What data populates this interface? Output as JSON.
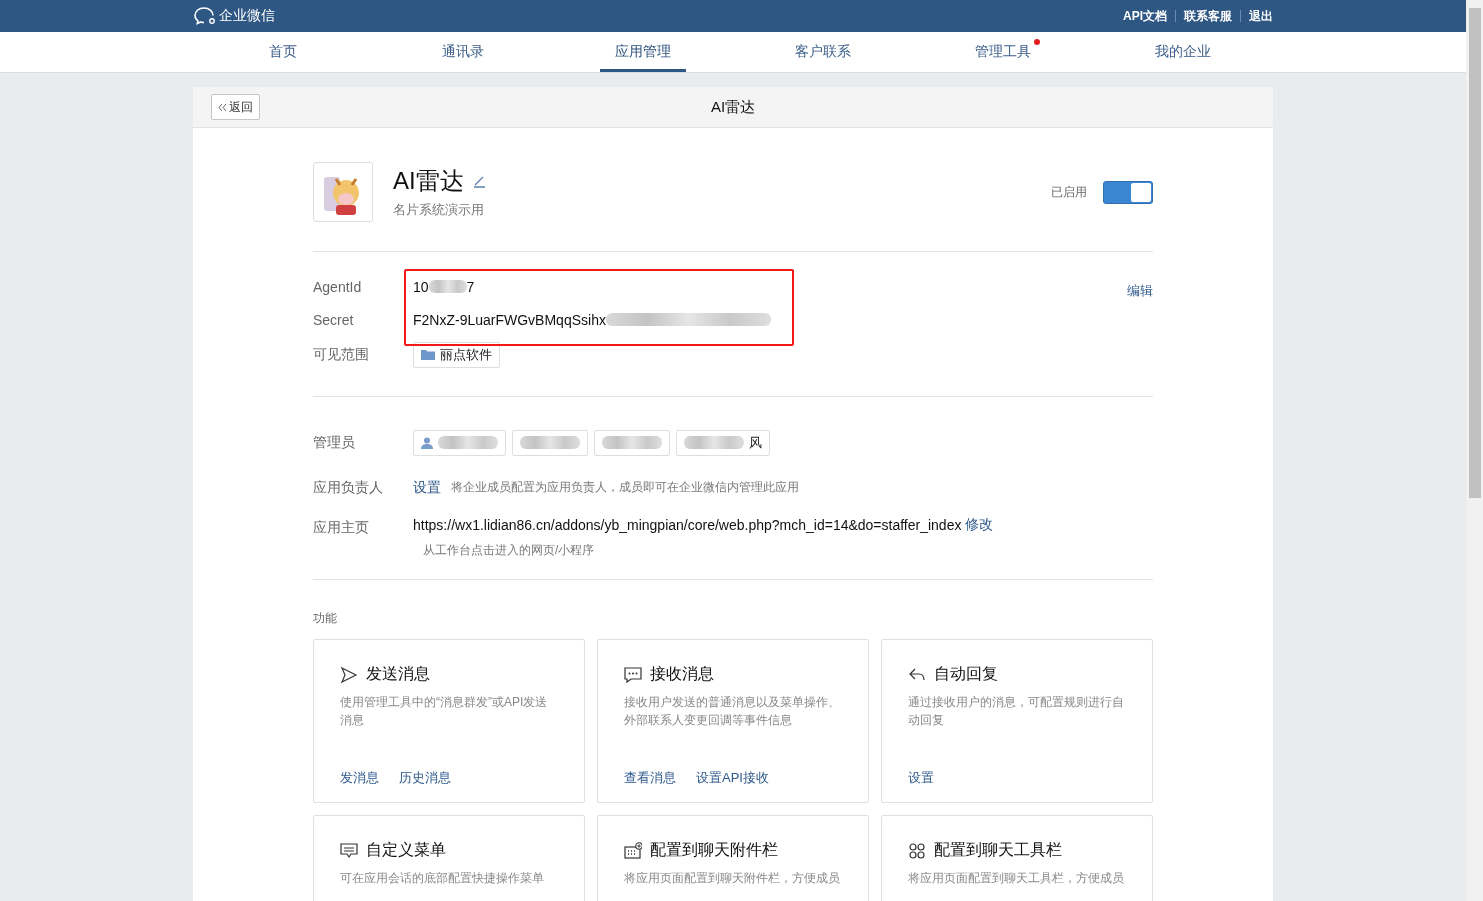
{
  "topbar": {
    "logo_text": "企业微信",
    "links": [
      "API文档",
      "联系客服",
      "退出"
    ]
  },
  "nav": [
    {
      "label": "首页",
      "selected": false,
      "badge": false
    },
    {
      "label": "通讯录",
      "selected": false,
      "badge": false
    },
    {
      "label": "应用管理",
      "selected": true,
      "badge": false
    },
    {
      "label": "客户联系",
      "selected": false,
      "badge": false
    },
    {
      "label": "管理工具",
      "selected": false,
      "badge": true
    },
    {
      "label": "我的企业",
      "selected": false,
      "badge": false
    }
  ],
  "page": {
    "back_button": "返回",
    "title": "AI雷达"
  },
  "app": {
    "name": "AI雷达",
    "description": "名片系统演示用",
    "status_label": "已启用",
    "enabled": true
  },
  "credentials": {
    "edit_link": "编辑",
    "agent_label": "AgentId",
    "agent_id_start": "10",
    "agent_id_end": "7",
    "secret_label": "Secret",
    "secret": "F2NxZ-9LuarFWGvBMqqSsihx"
  },
  "visibility": {
    "label": "可见范围",
    "scope": "丽点软件"
  },
  "admins": {
    "label": "管理员",
    "chips": [
      {
        "kind": "person"
      },
      {
        "kind": "plain"
      },
      {
        "kind": "plain"
      },
      {
        "kind": "plain",
        "text": "风"
      }
    ]
  },
  "owner": {
    "label": "应用负责人",
    "link": "设置",
    "hint": "将企业成员配置为应用负责人，成员即可在企业微信内管理此应用"
  },
  "homepage": {
    "label": "应用主页",
    "url": "https://wx1.lidian86.cn/addons/yb_mingpian/core/web.php?mch_id=14&do=staffer_index",
    "edit_link": "修改",
    "hint": "从工作台点击进入的网页/小程序"
  },
  "features": {
    "title": "功能",
    "cards": [
      {
        "kind": "send",
        "title": "发送消息",
        "description": "使用管理工具中的“消息群发”或API发送消息",
        "links": [
          "发消息",
          "历史消息"
        ]
      },
      {
        "kind": "receive",
        "title": "接收消息",
        "description": "接收用户发送的普通消息以及菜单操作、外部联系人变更回调等事件信息",
        "links": [
          "查看消息",
          "设置API接收"
        ]
      },
      {
        "kind": "reply",
        "title": "自动回复",
        "description": "通过接收用户的消息，可配置规则进行自动回复",
        "links": [
          "设置"
        ]
      },
      {
        "kind": "menu",
        "title": "自定义菜单",
        "description": "可在应用会话的底部配置快捷操作菜单"
      },
      {
        "kind": "attach",
        "title": "配置到聊天附件栏",
        "description": "将应用页面配置到聊天附件栏，方便成员"
      },
      {
        "kind": "toolbar",
        "title": "配置到聊天工具栏",
        "description": "将应用页面配置到聊天工具栏，方便成员"
      }
    ]
  }
}
